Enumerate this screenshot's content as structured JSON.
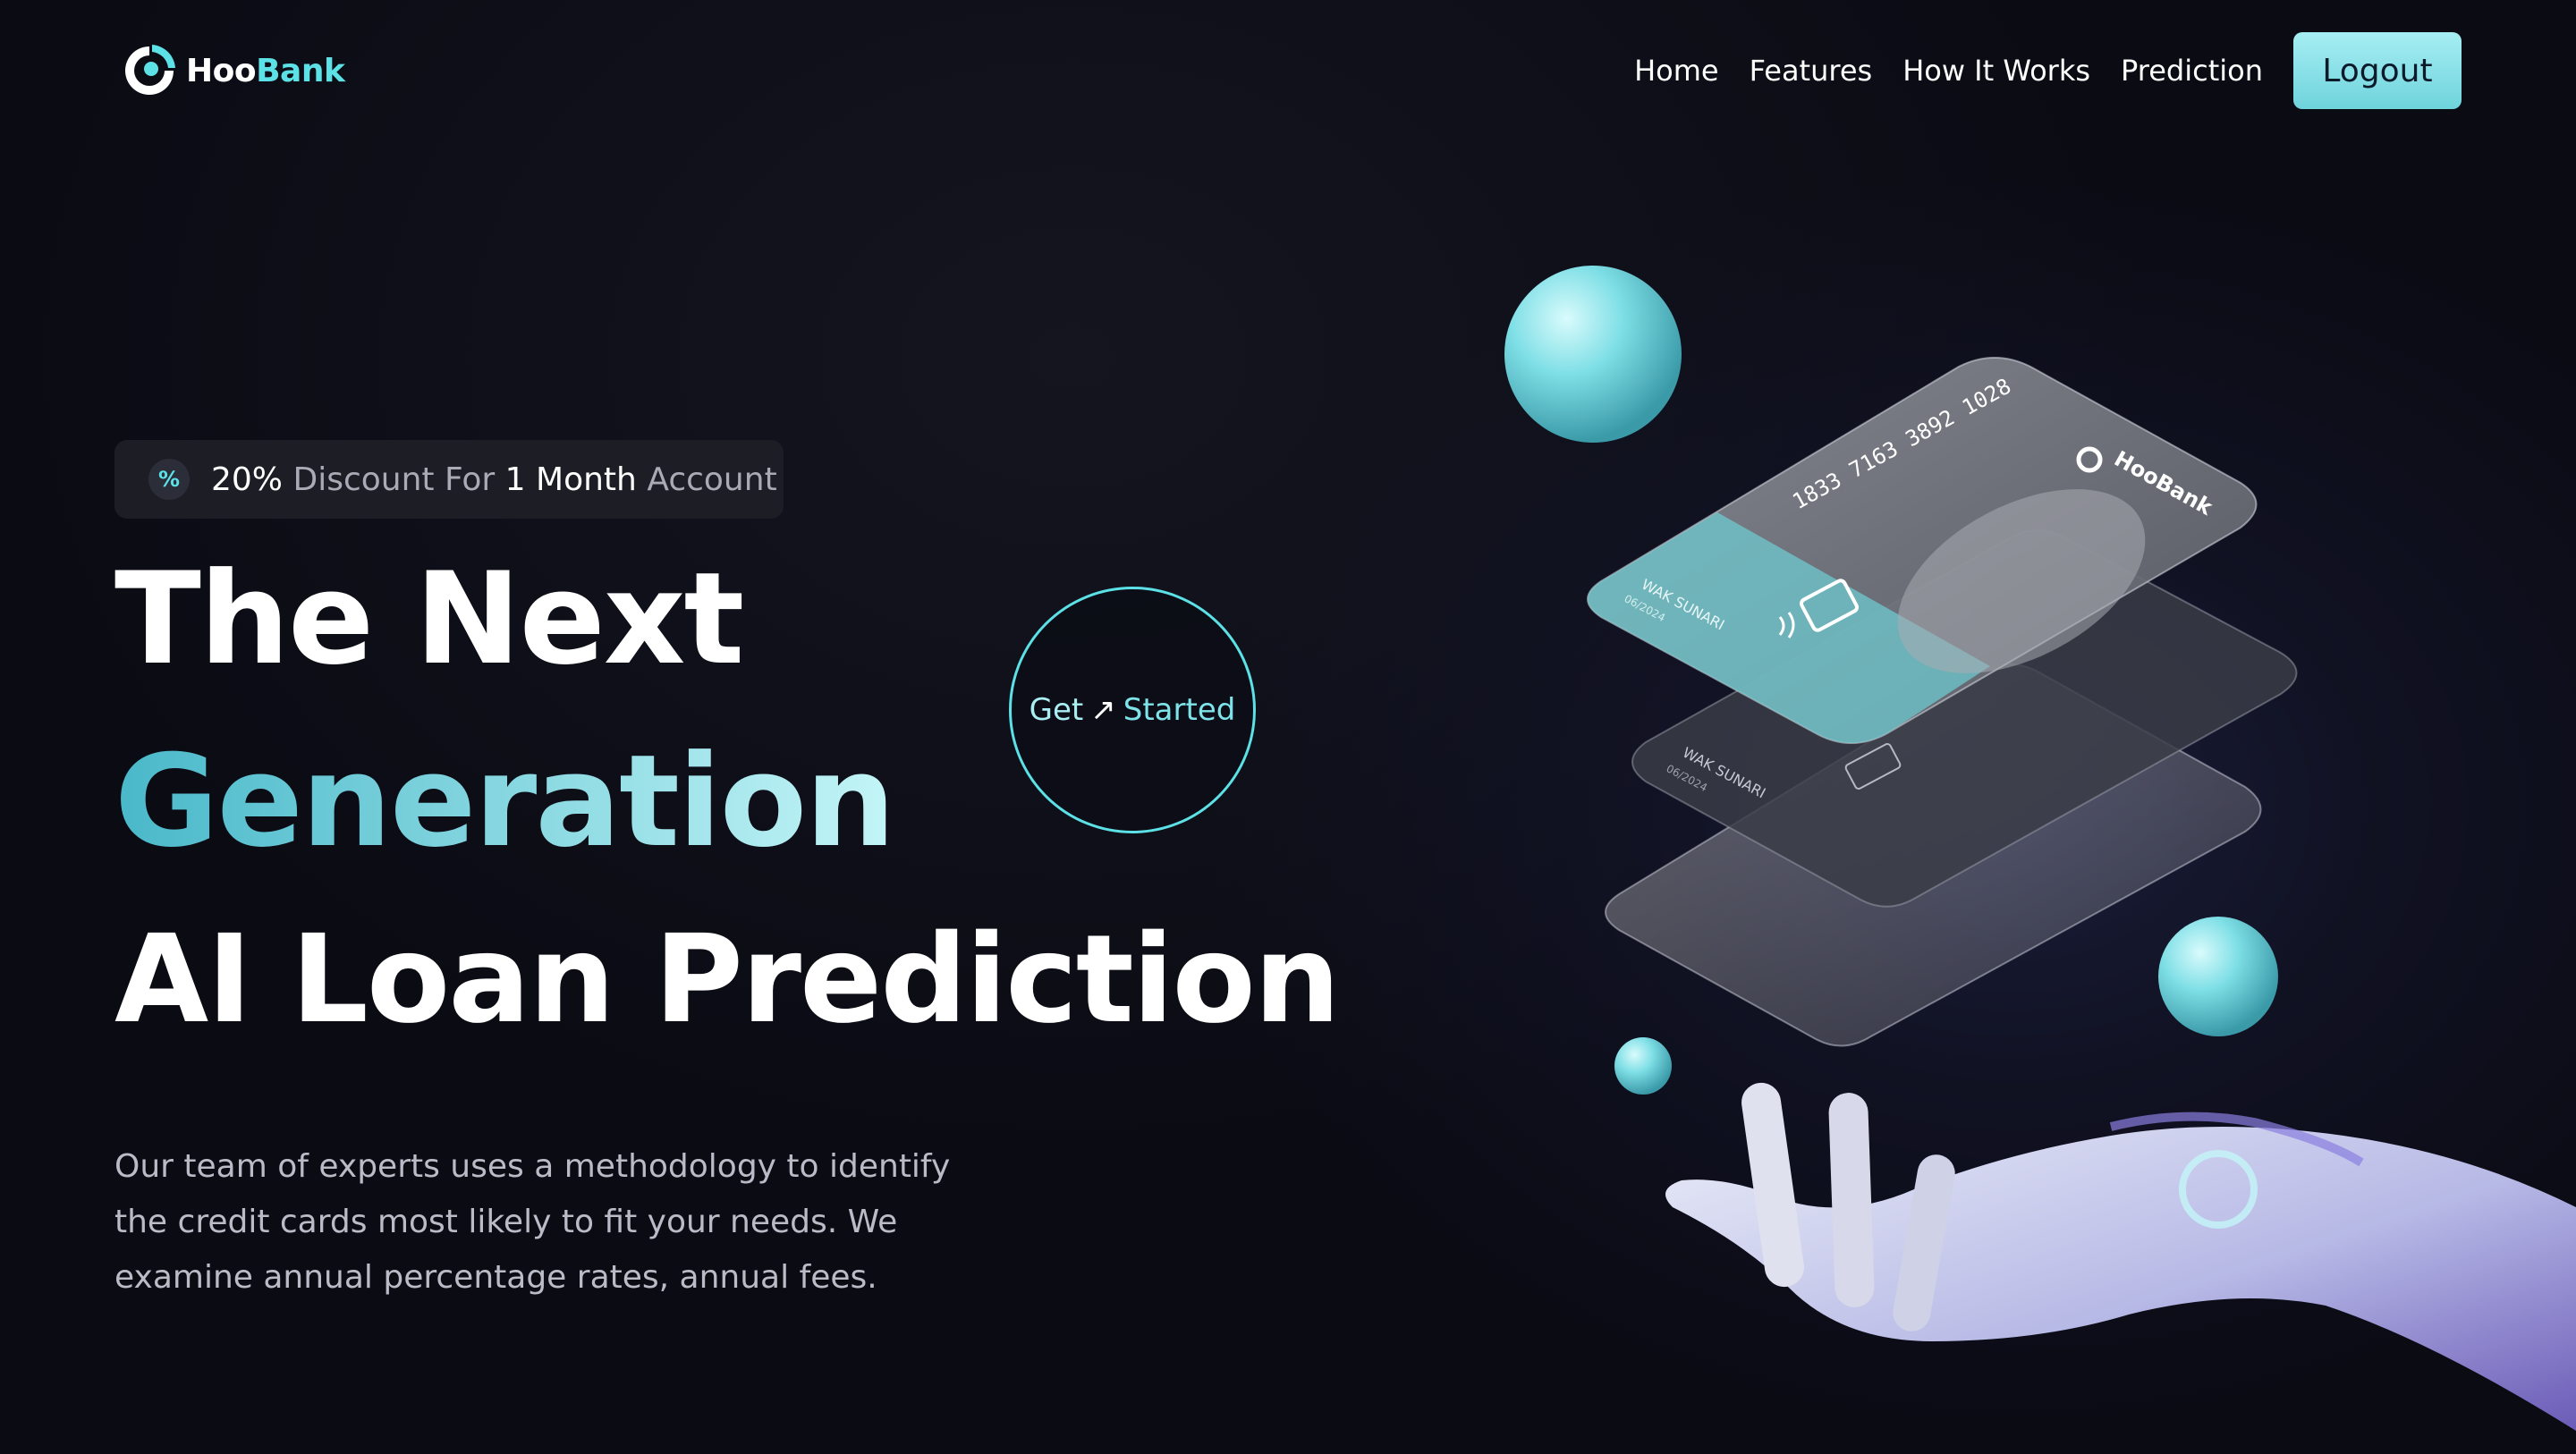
{
  "brand": {
    "name_part1": "Hoo",
    "name_part2": "Bank"
  },
  "nav": {
    "items": [
      {
        "label": "Home"
      },
      {
        "label": "Features"
      },
      {
        "label": "How It Works"
      },
      {
        "label": "Prediction"
      }
    ],
    "logout_label": "Logout"
  },
  "badge": {
    "icon": "percent-icon",
    "discount": "20%",
    "text1": "Discount For",
    "month_num": "1",
    "month_word": "Month",
    "text2": "Account"
  },
  "hero": {
    "line1": "The Next",
    "line2": "Generation",
    "line3": "AI Loan Prediction",
    "description": "Our team of experts uses a methodology to identify the credit cards most likely to fit your needs. We examine annual percentage rates, annual fees."
  },
  "cta": {
    "get": "Get",
    "arrow": "↗",
    "started": "Started"
  },
  "card_front": {
    "number": "1833 7163 3892 1028",
    "holder": "WAK SUNARI",
    "expiry": "06/2024",
    "brand": "HooBank"
  },
  "card_back": {
    "holder": "WAK SUNARI",
    "expiry": "06/2024"
  },
  "colors": {
    "accent": "#5ce1e6",
    "background": "#0b0b14",
    "badge_bg": "#1c1d25"
  }
}
